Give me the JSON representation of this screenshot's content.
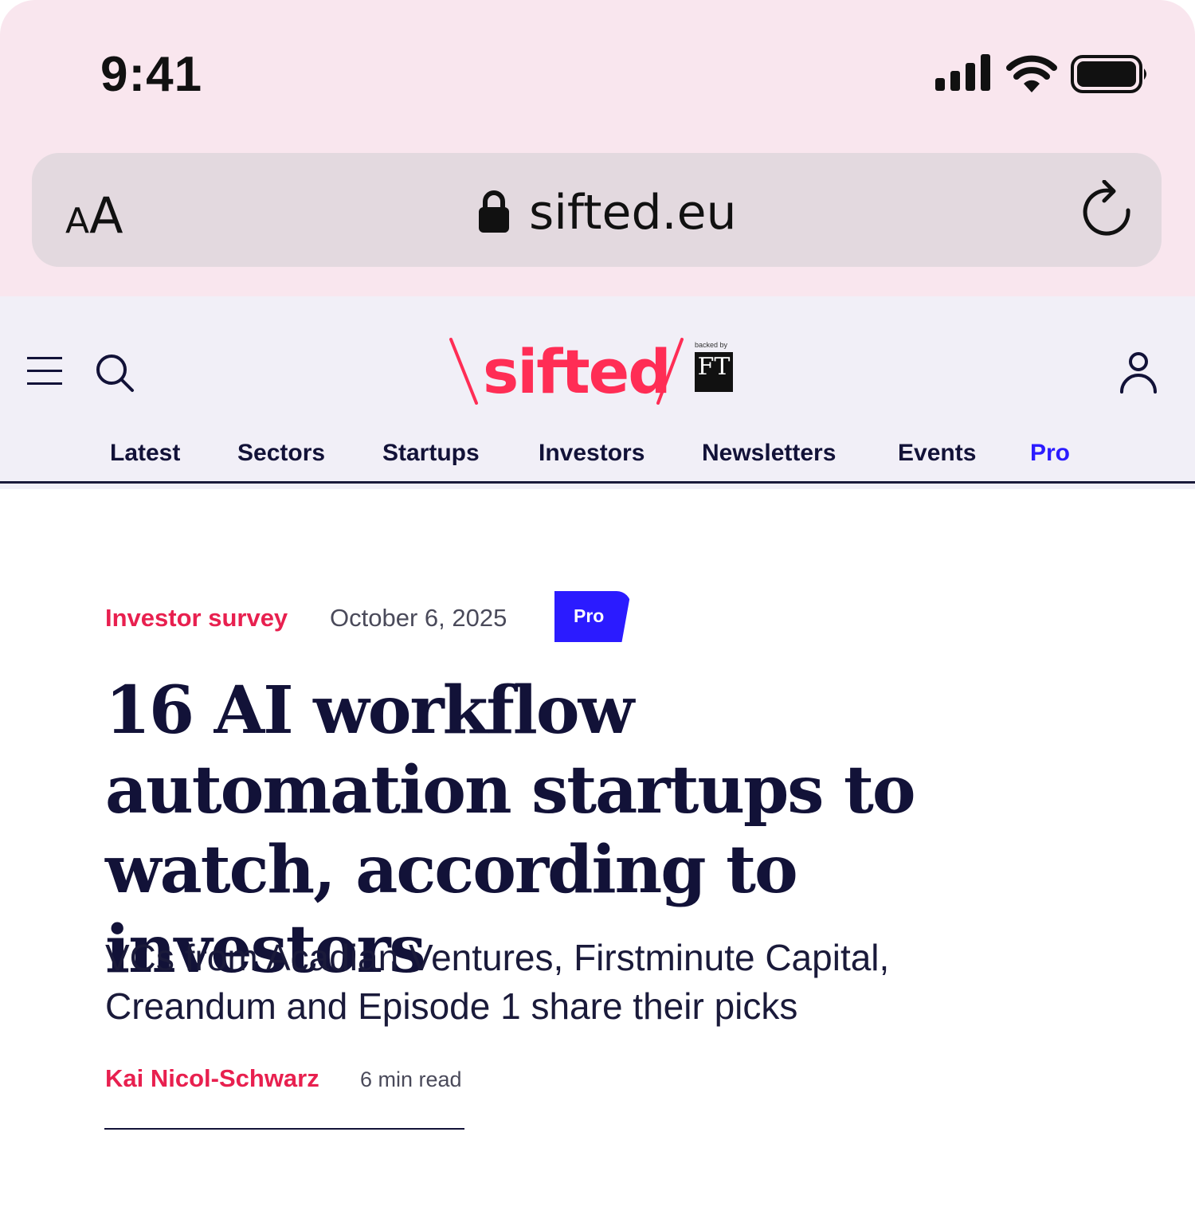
{
  "status_bar": {
    "time": "9:41",
    "icons": [
      "cellular-signal-icon",
      "wifi-icon",
      "battery-icon"
    ]
  },
  "browser": {
    "text_size_button": {
      "small": "A",
      "large": "A"
    },
    "url": "sifted.eu",
    "icons": [
      "lock-icon",
      "reload-icon"
    ]
  },
  "site_header": {
    "logo_text": "sifted",
    "backed_by": "backed by",
    "ft_mark": "FT",
    "icons": [
      "menu-icon",
      "search-icon",
      "account-icon"
    ],
    "nav": [
      {
        "label": "Latest"
      },
      {
        "label": "Sectors"
      },
      {
        "label": "Startups"
      },
      {
        "label": "Investors"
      },
      {
        "label": "Newsletters"
      },
      {
        "label": "Events"
      },
      {
        "label": "Pro"
      }
    ]
  },
  "article": {
    "category": "Investor survey",
    "date": "October 6, 2025",
    "badge": "Pro",
    "headline": "16 AI workflow automation startups to watch, according to investors",
    "standfirst": "VCs from Acadian Ventures, Firstminute Capital, Creandum and Episode 1 share their picks",
    "author": "Kai Nicol-Schwarz",
    "read_time": "6 min read"
  },
  "colors": {
    "chrome_bg": "#f9e6ee",
    "urlbar_bg": "#e3d9df",
    "header_bg": "#f1eff7",
    "brand_red": "#e8204f",
    "pro_blue": "#2b1bff",
    "navy": "#121238"
  }
}
